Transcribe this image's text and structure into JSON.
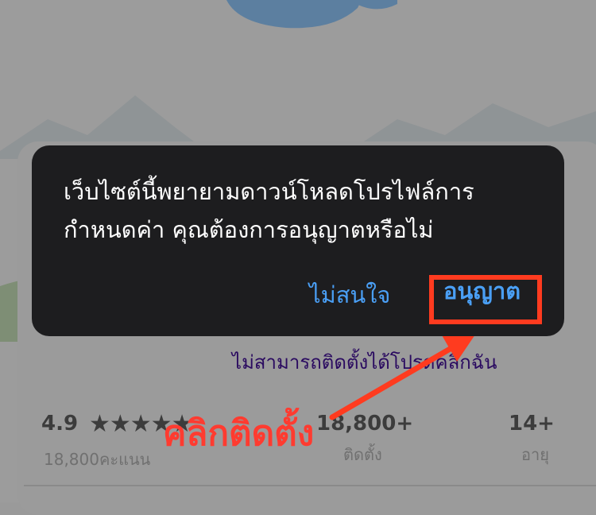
{
  "dialog": {
    "message": "เว็บไซต์นี้พยายามดาวน์โหลดโปรไฟล์การกำหนดค่า คุณต้องการอนุญาตหรือไม่",
    "deny_label": "ไม่สนใจ",
    "allow_label": "อนุญาต"
  },
  "page": {
    "fail_link": "ไม่สามารถติดตั้งได้โปรดคลิกฉัน",
    "rating_value": "4.9",
    "rating_count": "18,800คะแนน",
    "installs_value": "18,800+",
    "installs_label": "ติดตั้ง",
    "age_value": "14+",
    "age_label": "อายุ"
  },
  "annotation": {
    "text": "คลิกติดตั้ง"
  },
  "colors": {
    "dialog_bg": "#1d1d1f",
    "link_blue": "#4a9ff5",
    "annotation_red": "#ff3b30"
  }
}
